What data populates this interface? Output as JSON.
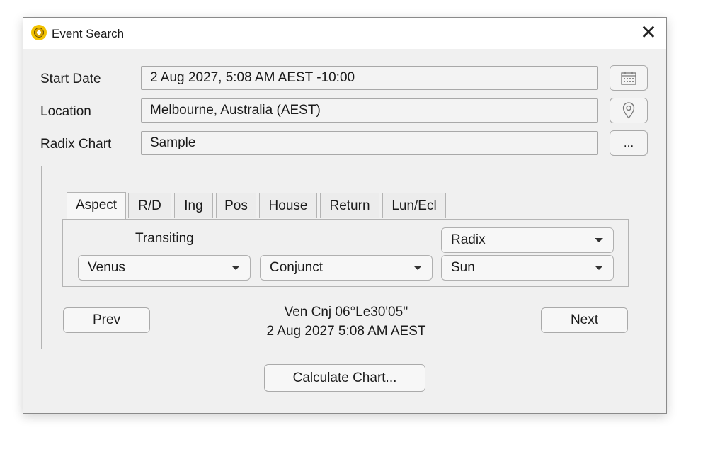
{
  "window": {
    "title": "Event Search",
    "app_icon": "app-logo-icon",
    "close_glyph": "✕"
  },
  "form": {
    "start_date": {
      "label": "Start Date",
      "value": "2 Aug 2027, 5:08 AM AEST -10:00",
      "button_icon": "calendar-icon"
    },
    "location": {
      "label": "Location",
      "value": "Melbourne, Australia (AEST)",
      "button_icon": "map-pin-icon"
    },
    "radix_chart": {
      "label": "Radix Chart",
      "value": "Sample",
      "button_label": "..."
    }
  },
  "tabs": [
    {
      "label": "Aspect",
      "active": true
    },
    {
      "label": "R/D",
      "active": false
    },
    {
      "label": "Ing",
      "active": false
    },
    {
      "label": "Pos",
      "active": false
    },
    {
      "label": "House",
      "active": false
    },
    {
      "label": "Return",
      "active": false
    },
    {
      "label": "Lun/Ecl",
      "active": false
    }
  ],
  "aspect_panel": {
    "transiting_label": "Transiting",
    "target_type": "Radix",
    "transiting_planet": "Venus",
    "aspect": "Conjunct",
    "target_planet": "Sun"
  },
  "navigation": {
    "prev_label": "Prev",
    "next_label": "Next",
    "result_line1": "Ven Cnj 06°Le30'05''",
    "result_line2": "2 Aug 2027 5:08 AM AEST"
  },
  "actions": {
    "calculate_label": "Calculate Chart..."
  }
}
